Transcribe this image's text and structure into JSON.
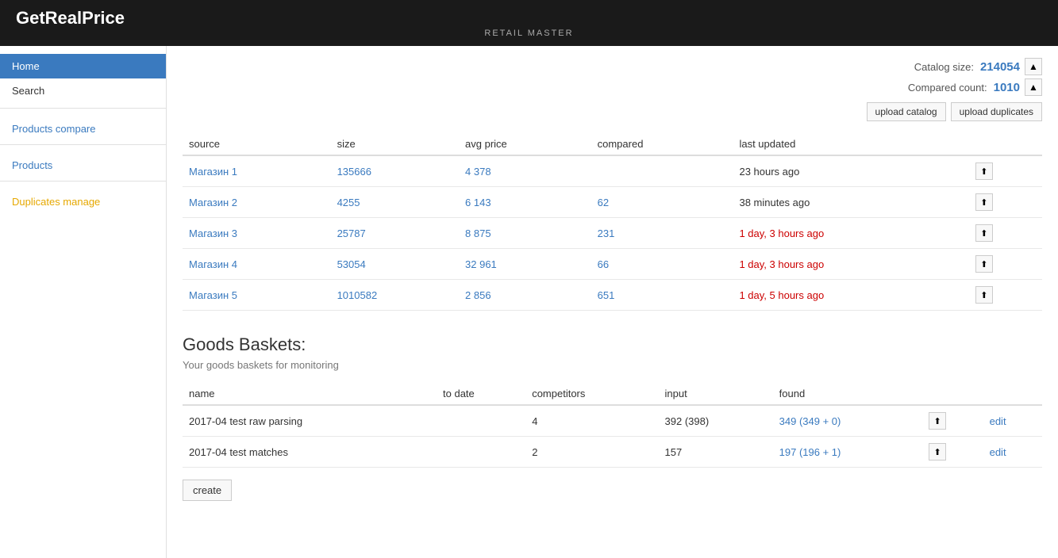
{
  "header": {
    "title": "GetRealPrice",
    "subtitle": "RETAIL MASTER"
  },
  "sidebar": {
    "home_label": "Home",
    "search_label": "Search",
    "products_compare_label": "Products compare",
    "products_label": "Products",
    "duplicates_label": "Duplicates manage"
  },
  "stats": {
    "catalog_size_label": "Catalog size:",
    "catalog_size_value": "214054",
    "compared_count_label": "Compared count:",
    "compared_count_value": "1010",
    "upload_catalog_label": "upload catalog",
    "upload_duplicates_label": "upload duplicates"
  },
  "products_table": {
    "columns": [
      "source",
      "size",
      "avg price",
      "compared",
      "last updated"
    ],
    "rows": [
      {
        "source": "Магазин 1",
        "size": "135666",
        "avg_price": "4 378",
        "compared": "",
        "last_updated": "23 hours ago"
      },
      {
        "source": "Магазин 2",
        "size": "4255",
        "avg_price": "6 143",
        "compared": "62",
        "last_updated": "38 minutes ago"
      },
      {
        "source": "Магазин 3",
        "size": "25787",
        "avg_price": "8 875",
        "compared": "231",
        "last_updated": "1 day, 3 hours ago"
      },
      {
        "source": "Магазин 4",
        "size": "53054",
        "avg_price": "32 961",
        "compared": "66",
        "last_updated": "1 day, 3 hours ago"
      },
      {
        "source": "Магазин 5",
        "size": "1010582",
        "avg_price": "2 856",
        "compared": "651",
        "last_updated": "1 day, 5 hours ago"
      }
    ]
  },
  "goods_baskets": {
    "title": "Goods Baskets:",
    "subtitle": "Your goods baskets for monitoring",
    "columns": [
      "name",
      "to date",
      "competitors",
      "input",
      "found"
    ],
    "rows": [
      {
        "name": "2017-04 test raw parsing",
        "to_date": "",
        "competitors": "4",
        "input": "392 (398)",
        "found": "349 (349 + 0)",
        "found_link": "349"
      },
      {
        "name": "2017-04 test matches",
        "to_date": "",
        "competitors": "2",
        "input": "157",
        "found": "197 (196 + 1)",
        "found_link": "197"
      }
    ],
    "create_label": "create"
  }
}
